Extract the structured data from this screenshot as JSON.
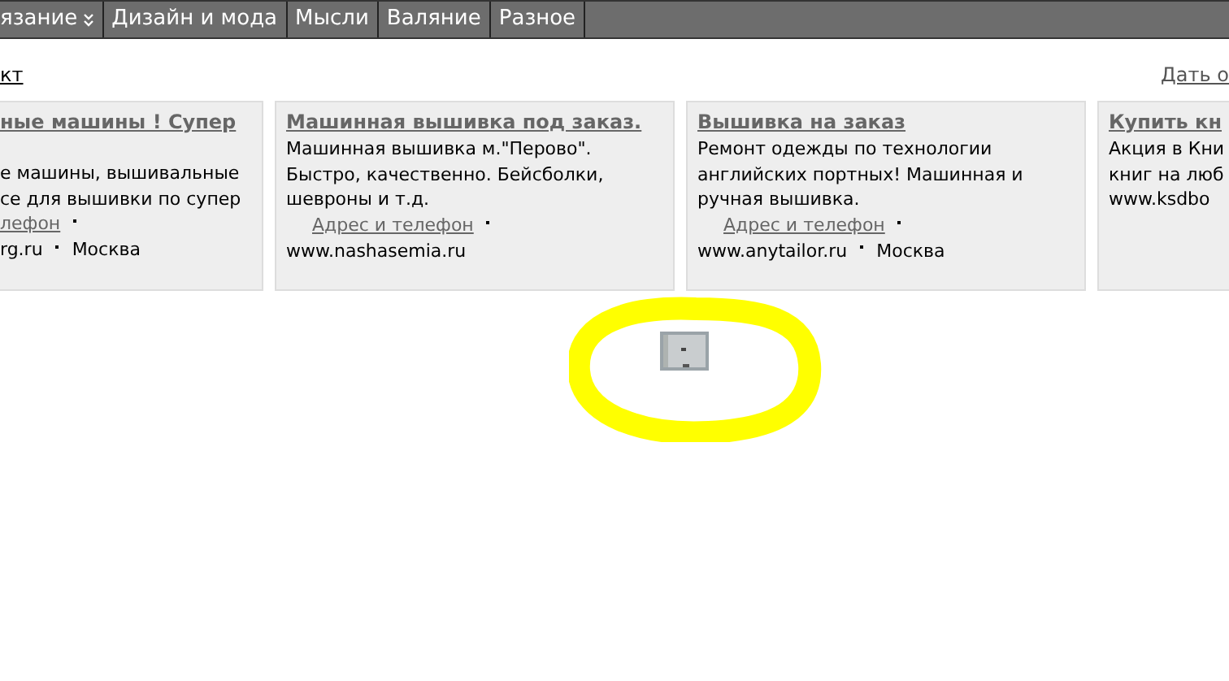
{
  "menu": [
    {
      "label": "язание",
      "dropdown": true
    },
    {
      "label": "Дизайн и мода",
      "dropdown": false
    },
    {
      "label": "Мысли",
      "dropdown": false
    },
    {
      "label": "Валяние",
      "dropdown": false
    },
    {
      "label": "Разное",
      "dropdown": false
    }
  ],
  "left_link": "кт",
  "right_link": "Дать о",
  "ads": [
    {
      "title": "ные машины ! Супер",
      "lines": [
        "е машины, вышивальные",
        "се для вышивки по супер"
      ],
      "contact": "лефон",
      "domain": "rg.ru",
      "city": "Москва"
    },
    {
      "title": "Машинная вышивка под заказ.",
      "lines": [
        "Машинная вышивка м.\"Перово\".",
        "Быстро, качественно. Бейсболки,",
        "шевроны и т.д."
      ],
      "contact": "Адрес и телефон",
      "domain": "www.nashasemia.ru"
    },
    {
      "title": "Вышивка на заказ",
      "lines": [
        "Ремонт одежды по технологии",
        "английских портных! Машинная и",
        "ручная вышивка."
      ],
      "contact": "Адрес и телефон",
      "domain": "www.anytailor.ru",
      "city": "Москва"
    },
    {
      "title": "Купить кн",
      "lines": [
        "Акция в Кни",
        "книг на люб"
      ],
      "domain": "www.ksdbo"
    }
  ]
}
